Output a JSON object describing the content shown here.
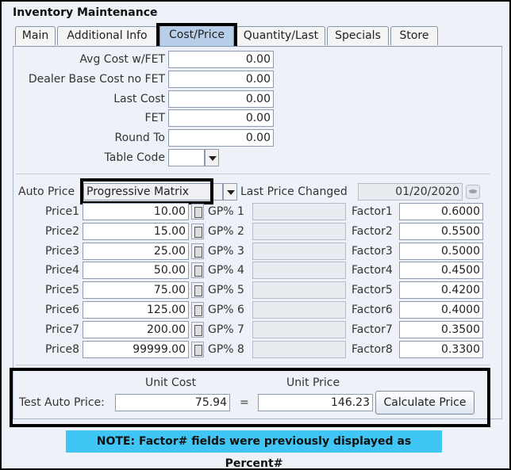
{
  "window": {
    "title": "Inventory Maintenance"
  },
  "tabs": [
    "Main",
    "Additional Info",
    "Cost/Price",
    "Quantity/Last",
    "Specials",
    "Store"
  ],
  "active_tab": "Cost/Price",
  "costs": {
    "avg_cost_label": "Avg Cost w/FET",
    "avg_cost": "0.00",
    "dealer_base_label": "Dealer Base Cost no FET",
    "dealer_base": "0.00",
    "last_cost_label": "Last Cost",
    "last_cost": "0.00",
    "fet_label": "FET",
    "fet": "0.00",
    "round_to_label": "Round To",
    "round_to": "0.00",
    "table_code_label": "Table Code",
    "table_code": ""
  },
  "auto_price": {
    "label": "Auto Price",
    "value": "Progressive Matrix",
    "last_changed_label": "Last Price Changed",
    "last_changed": "01/20/2020"
  },
  "prices": [
    {
      "label": "Price1",
      "value": "10.00",
      "gp_label": "GP% 1",
      "gp": "",
      "factor_label": "Factor1",
      "factor": "0.6000"
    },
    {
      "label": "Price2",
      "value": "15.00",
      "gp_label": "GP% 2",
      "gp": "",
      "factor_label": "Factor2",
      "factor": "0.5500"
    },
    {
      "label": "Price3",
      "value": "25.00",
      "gp_label": "GP% 3",
      "gp": "",
      "factor_label": "Factor3",
      "factor": "0.5000"
    },
    {
      "label": "Price4",
      "value": "50.00",
      "gp_label": "GP% 4",
      "gp": "",
      "factor_label": "Factor4",
      "factor": "0.4500"
    },
    {
      "label": "Price5",
      "value": "75.00",
      "gp_label": "GP% 5",
      "gp": "",
      "factor_label": "Factor5",
      "factor": "0.4200"
    },
    {
      "label": "Price6",
      "value": "125.00",
      "gp_label": "GP% 6",
      "gp": "",
      "factor_label": "Factor6",
      "factor": "0.4000"
    },
    {
      "label": "Price7",
      "value": "200.00",
      "gp_label": "GP% 7",
      "gp": "",
      "factor_label": "Factor7",
      "factor": "0.3500"
    },
    {
      "label": "Price8",
      "value": "99999.00",
      "gp_label": "GP% 8",
      "gp": "",
      "factor_label": "Factor8",
      "factor": "0.3300"
    }
  ],
  "test": {
    "unit_cost_header": "Unit Cost",
    "unit_price_header": "Unit Price",
    "label": "Test Auto Price:",
    "unit_cost": "75.94",
    "equals": "=",
    "unit_price": "146.23",
    "button_label": "Calculate Price"
  },
  "note": "NOTE: Factor# fields were previously displayed as Percent#",
  "colors": {
    "note_bg": "#3fc6f4",
    "active_tab": "#b8cfe9",
    "panel_bg": "#eef2f8"
  }
}
